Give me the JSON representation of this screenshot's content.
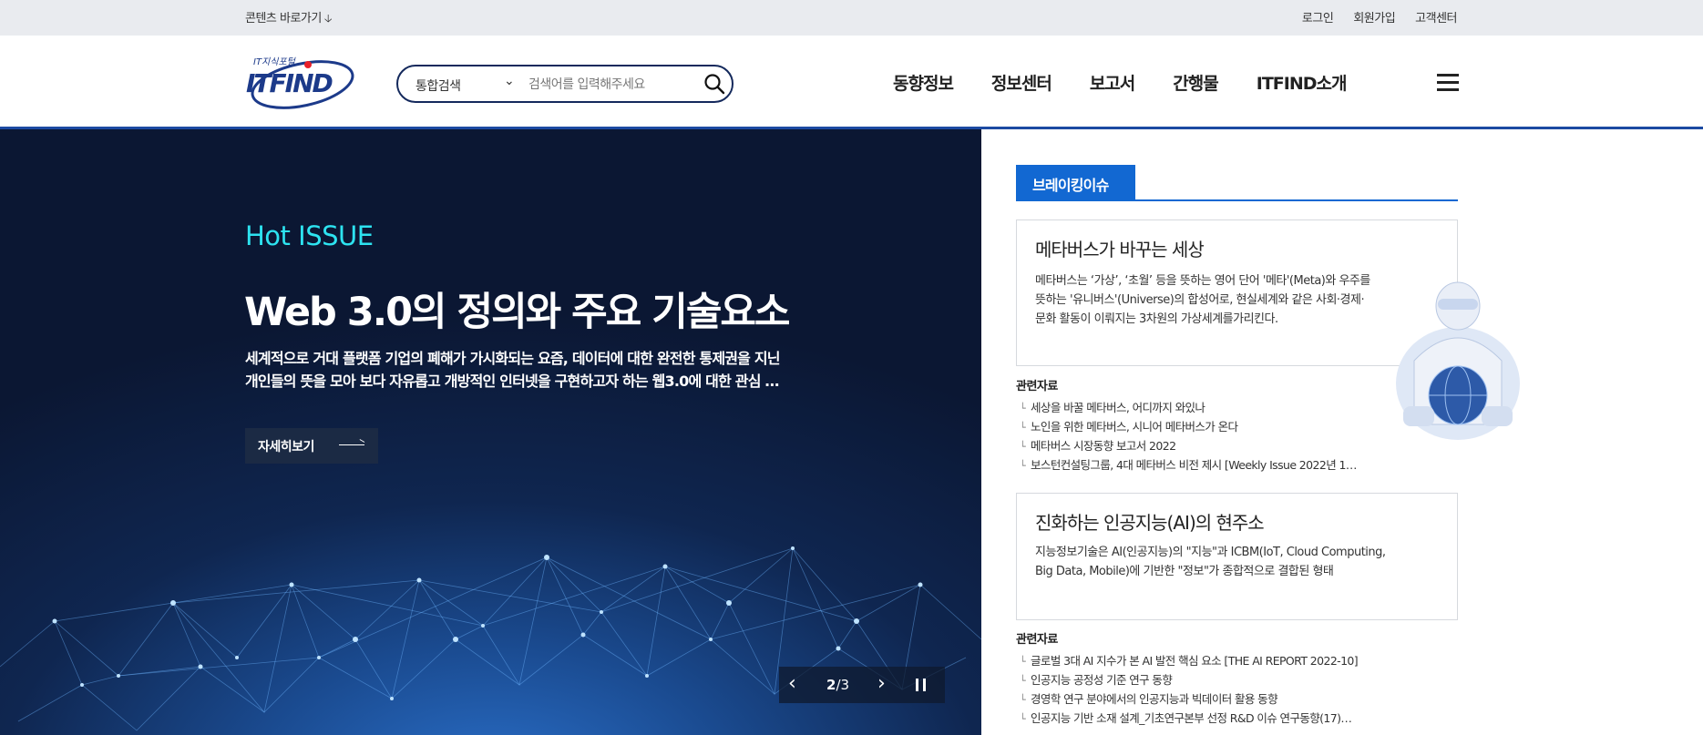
{
  "topbar": {
    "skip_link": "콘텐츠 바로가기",
    "links": [
      "로그인",
      "회원가입",
      "고객센터"
    ]
  },
  "header": {
    "logo_sub": "IT지식포털",
    "logo_main": "ITFIND",
    "search": {
      "scope": "통합검색",
      "placeholder": "검색어를 입력해주세요"
    },
    "nav": [
      "동향정보",
      "정보센터",
      "보고서",
      "간행물",
      "ITFIND소개"
    ]
  },
  "hero": {
    "label": "Hot ISSUE",
    "title": "Web 3.0의 정의와 주요 기술요소",
    "desc_line1": "세계적으로 거대 플랫폼 기업의 폐해가 가시화되는 요즘, 데이터에 대한 완전한 통제권을 지닌",
    "desc_line2": "개인들의 뜻을 모아 보다 자유롭고 개방적인 인터넷을 구현하고자 하는 웹3.0에 대한 관심 …",
    "button": "자세히보기",
    "slide_current": "2",
    "slide_sep": "/",
    "slide_total": "3"
  },
  "breaking": {
    "tab_label": "브레이킹이슈",
    "issues": [
      {
        "title": "메타버스가 바꾸는 세상",
        "text": "메타버스는 ‘가상’, ‘초월’ 등을 뜻하는 영어 단어 '메타'(Meta)와 우주를 뜻하는 '유니버스'(Universe)의 합성어로, 현실세계와 같은 사회·경제·문화 활동이 이뤄지는 3차원의 가상세계를가리킨다.",
        "related_label": "관련자료",
        "related": [
          "세상을 바꿀 메타버스, 어디까지 와있나",
          "노인을 위한 메타버스, 시니어 메타버스가 온다",
          "메타버스 시장동향 보고서 2022",
          "보스턴컨설팅그룹, 4대 메타버스 비전 제시 [Weekly Issue 2022년 1…"
        ]
      },
      {
        "title": "진화하는 인공지능(AI)의 현주소",
        "text": "지능정보기술은 AI(인공지능)의 \"지능\"과 ICBM(IoT, Cloud Computing, Big Data, Mobile)에 기반한 \"정보\"가 종합적으로 결합된 형태",
        "related_label": "관련자료",
        "related": [
          "글로벌 3대 AI 지수가 본 AI 발전 핵심 요소 [THE AI REPORT 2022-10]",
          "인공지능 공정성 기준 연구 동향",
          "경영학 연구 분야에서의 인공지능과 빅데이터 활용 동향",
          "인공지능 기반 소재 설계_기초연구본부 선정 R&D 이슈 연구동향(17)…"
        ]
      }
    ]
  },
  "colors": {
    "accent": "#1268d2",
    "hot": "#2de3f0",
    "navy": "#14295c"
  }
}
